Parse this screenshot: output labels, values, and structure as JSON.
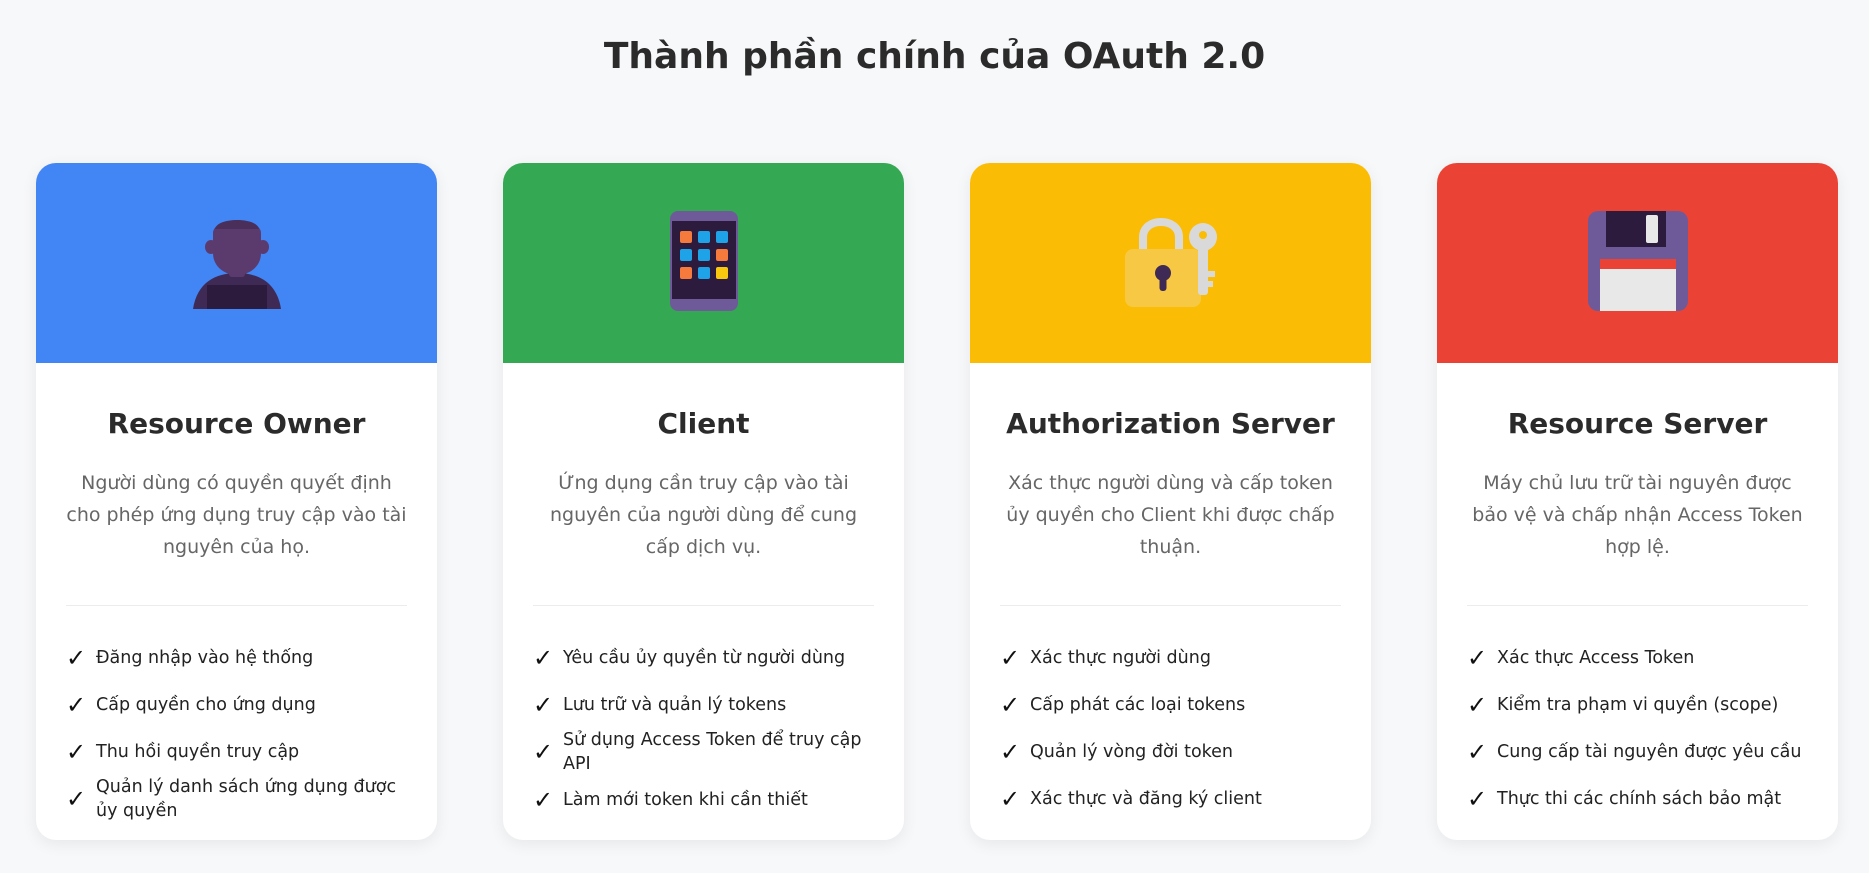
{
  "page": {
    "title": "Thành phần chính của OAuth 2.0"
  },
  "colors": {
    "background": "#f7f8fa",
    "resource_owner": "#4285f4",
    "client": "#34a853",
    "authorization_server": "#fbbc05",
    "resource_server": "#ea4335"
  },
  "check_symbol": "✓",
  "cards": [
    {
      "title": "Resource Owner",
      "icon": "person-icon",
      "description": "Người dùng có quyền quyết định cho phép ứng dụng truy cập vào tài nguyên của họ.",
      "features": [
        "Đăng nhập vào hệ thống",
        "Cấp quyền cho ứng dụng",
        "Thu hồi quyền truy cập",
        "Quản lý danh sách ứng dụng được ủy quyền"
      ]
    },
    {
      "title": "Client",
      "icon": "app-grid-phone-icon",
      "description": "Ứng dụng cần truy cập vào tài nguyên của người dùng để cung cấp dịch vụ.",
      "features": [
        "Yêu cầu ủy quyền từ người dùng",
        "Lưu trữ và quản lý tokens",
        "Sử dụng Access Token để truy cập API",
        "Làm mới token khi cần thiết"
      ]
    },
    {
      "title": "Authorization Server",
      "icon": "lock-key-icon",
      "description": "Xác thực người dùng và cấp token ủy quyền cho Client khi được chấp thuận.",
      "features": [
        "Xác thực người dùng",
        "Cấp phát các loại tokens",
        "Quản lý vòng đời token",
        "Xác thực và đăng ký client"
      ]
    },
    {
      "title": "Resource Server",
      "icon": "floppy-disk-icon",
      "description": "Máy chủ lưu trữ tài nguyên được bảo vệ và chấp nhận Access Token hợp lệ.",
      "features": [
        "Xác thực Access Token",
        "Kiểm tra phạm vi quyền (scope)",
        "Cung cấp tài nguyên được yêu cầu",
        "Thực thi các chính sách bảo mật"
      ]
    }
  ]
}
